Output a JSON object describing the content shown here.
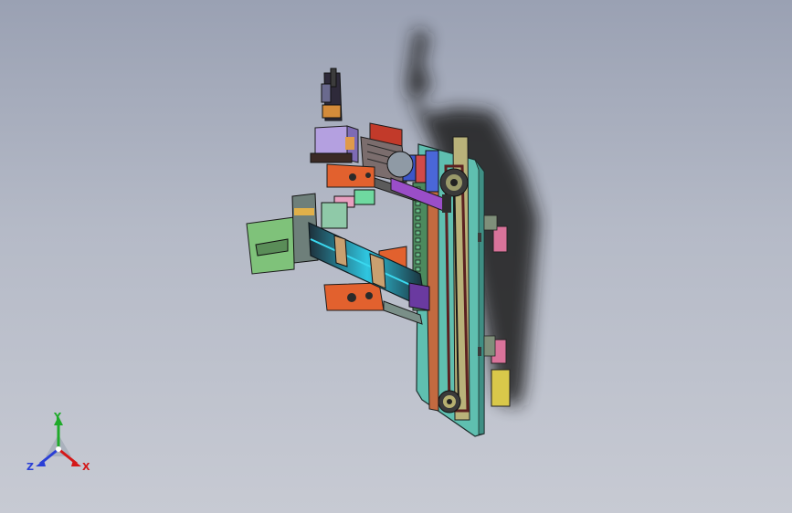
{
  "triad": {
    "x_label": "X",
    "y_label": "Y",
    "z_label": "Z",
    "x_color": "#d41818",
    "y_color": "#1faa2a",
    "z_color": "#2a3fd6"
  }
}
